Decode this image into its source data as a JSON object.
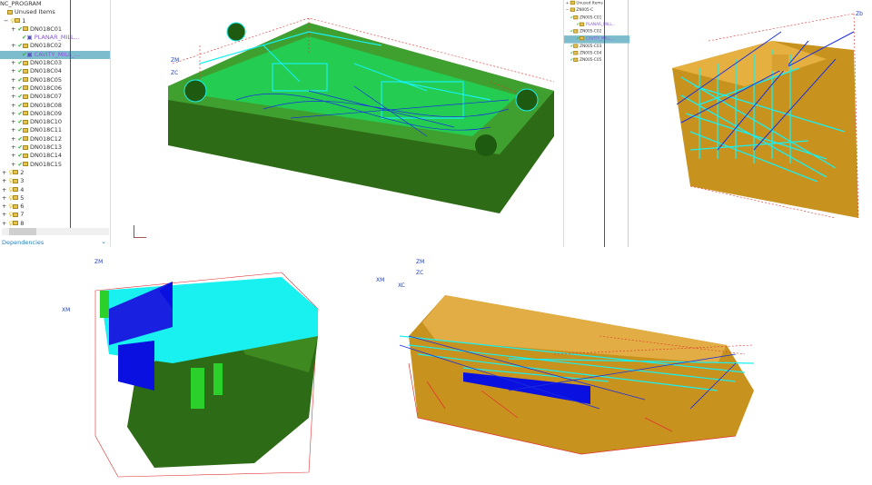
{
  "left_tree": {
    "root": "NC_PROGRAM",
    "unused": "Unused Items",
    "group": "1",
    "items": [
      {
        "label": "DN018C01",
        "indent": 2
      },
      {
        "label": "PLANAR_MILL...",
        "indent": 3,
        "op": true
      },
      {
        "label": "DN018C02",
        "indent": 2
      },
      {
        "label": "CAVITY_MILL_...",
        "indent": 3,
        "op": true,
        "selected": true
      },
      {
        "label": "DN018C03",
        "indent": 2
      },
      {
        "label": "DN018C04",
        "indent": 2
      },
      {
        "label": "DN018C05",
        "indent": 2
      },
      {
        "label": "DN018C06",
        "indent": 2
      },
      {
        "label": "DN018C07",
        "indent": 2
      },
      {
        "label": "DN018C08",
        "indent": 2
      },
      {
        "label": "DN018C09",
        "indent": 2
      },
      {
        "label": "DN018C10",
        "indent": 2
      },
      {
        "label": "DN018C11",
        "indent": 2
      },
      {
        "label": "DN018C12",
        "indent": 2
      },
      {
        "label": "DN018C13",
        "indent": 2
      },
      {
        "label": "DN018C14",
        "indent": 2
      },
      {
        "label": "DN018C15",
        "indent": 2
      }
    ],
    "groups": [
      "2",
      "3",
      "4",
      "5",
      "6",
      "7",
      "8"
    ],
    "footer": "Dependencies"
  },
  "right_tree": {
    "unused": "Unused Items",
    "group": "ZN005-C",
    "items": [
      {
        "label": "ZN005-C01"
      },
      {
        "label": "PLANAR_MILL...",
        "op": true
      },
      {
        "label": "ZN005-C02"
      },
      {
        "label": "CAVITY_MILL_...",
        "op": true,
        "selected": true
      },
      {
        "label": "ZN005-C03"
      },
      {
        "label": "ZN005-C04"
      },
      {
        "label": "ZN005-C05"
      }
    ]
  },
  "axes": {
    "zm": "ZM",
    "zc": "ZC",
    "xm": "XM",
    "xc": "XC",
    "zb": "Zb"
  },
  "colors": {
    "green": "#2e6b16",
    "cyan": "#19f0f0",
    "gold": "#c8921e",
    "blue": "#0a10e0",
    "red": "#e03030"
  }
}
